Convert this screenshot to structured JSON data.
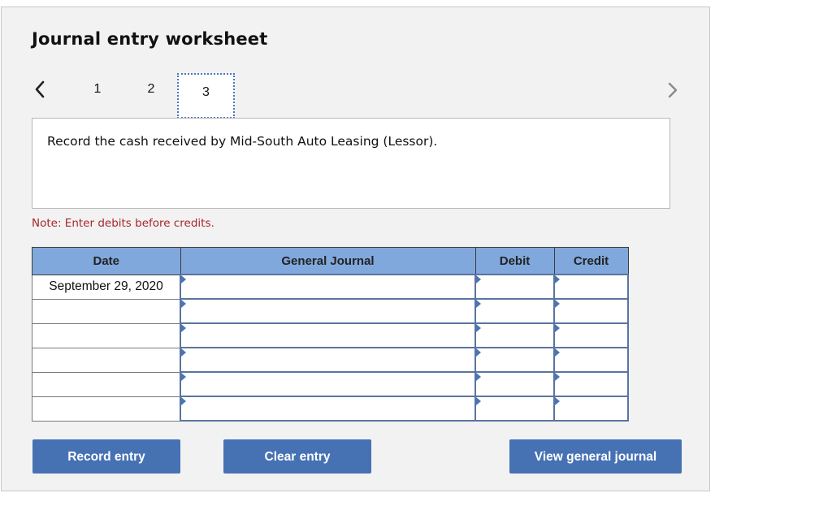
{
  "header": {
    "title": "Journal entry worksheet"
  },
  "navigation": {
    "prev_icon": "chevron-left-icon",
    "next_icon": "chevron-right-icon",
    "steps": [
      {
        "label": "1",
        "active": false
      },
      {
        "label": "2",
        "active": false
      },
      {
        "label": "3",
        "active": true
      }
    ]
  },
  "prompt": {
    "text": "Record the cash received by Mid-South Auto Leasing (Lessor)."
  },
  "note": {
    "text": "Note: Enter debits before credits.",
    "color": "#a8252a"
  },
  "table": {
    "columns": [
      "Date",
      "General Journal",
      "Debit",
      "Credit"
    ],
    "header_color": "#80a8dc",
    "rows": [
      {
        "date": "September 29, 2020",
        "account": "",
        "debit": "",
        "credit": ""
      },
      {
        "date": "",
        "account": "",
        "debit": "",
        "credit": ""
      },
      {
        "date": "",
        "account": "",
        "debit": "",
        "credit": ""
      },
      {
        "date": "",
        "account": "",
        "debit": "",
        "credit": ""
      },
      {
        "date": "",
        "account": "",
        "debit": "",
        "credit": ""
      },
      {
        "date": "",
        "account": "",
        "debit": "",
        "credit": ""
      }
    ]
  },
  "buttons": {
    "record_entry": "Record entry",
    "clear_entry": "Clear entry",
    "view_general_journal": "View general journal",
    "color": "#4672b4"
  }
}
